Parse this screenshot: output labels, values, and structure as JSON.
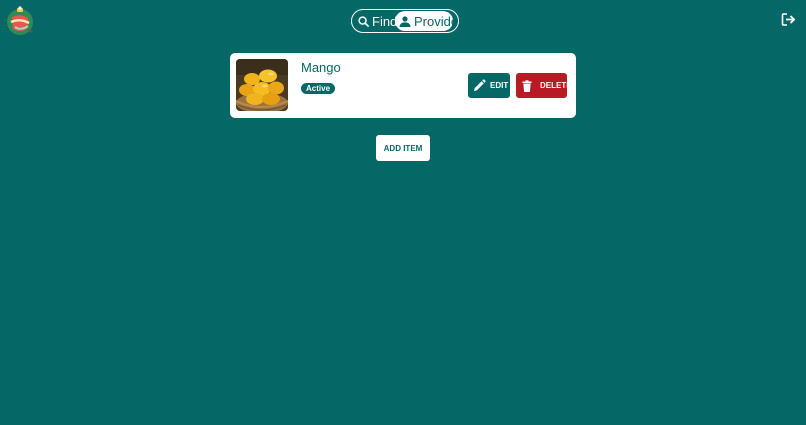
{
  "header": {
    "logo_icon": "holiday-gift-ornament-logo",
    "toggle": {
      "find_label": "Find",
      "find_icon": "search-icon",
      "provide_label": "Provide",
      "provide_icon": "user-icon",
      "selected": "Provide"
    },
    "logout_icon": "logout-icon"
  },
  "items": [
    {
      "name": "Mango",
      "status": "Active",
      "image": "mango-photo",
      "edit_label": "EDIT",
      "edit_icon": "pencil-icon",
      "delete_label": "DELETE",
      "delete_icon": "trash-icon"
    }
  ],
  "add_item_label": "ADD ITEM",
  "colors": {
    "background": "#066866",
    "card": "#ffffff",
    "edit_button": "#066866",
    "delete_button": "#b71c24"
  }
}
